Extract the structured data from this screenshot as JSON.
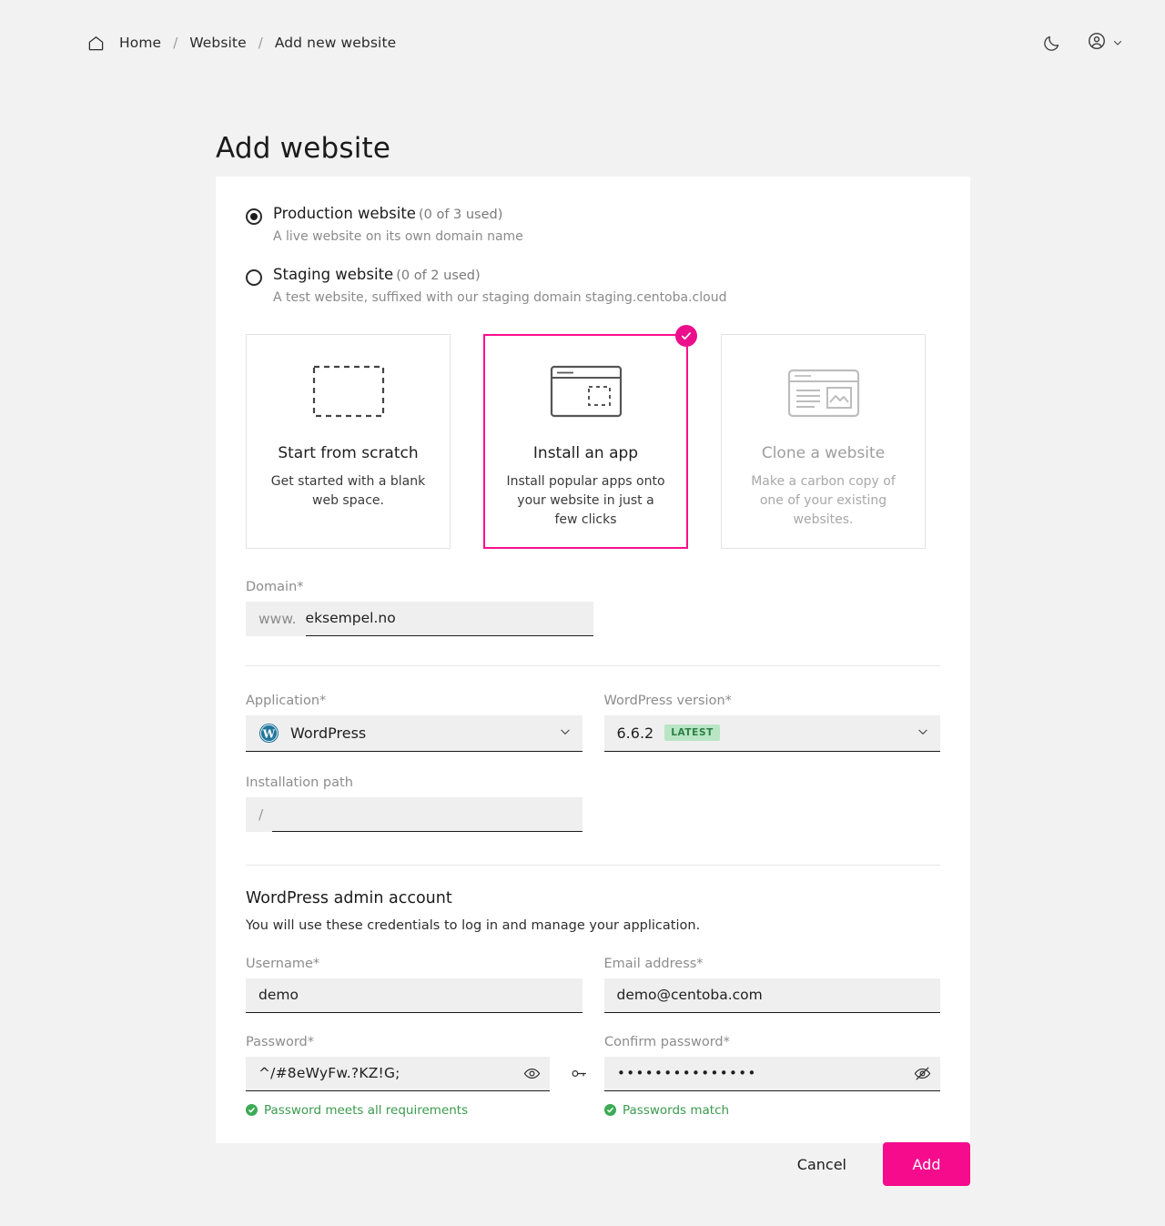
{
  "breadcrumb": {
    "home_icon": "home-icon",
    "items": [
      {
        "label": "Home"
      },
      {
        "label": "Website"
      },
      {
        "label": "Add new website"
      }
    ],
    "separator": "/"
  },
  "topbar": {
    "theme_icon": "moon-icon",
    "account_icon": "user-circle-icon",
    "account_chevron": "chevron-down-icon"
  },
  "page": {
    "title": "Add website"
  },
  "website_type": {
    "options": [
      {
        "title": "Production website",
        "count": "(0 of 3 used)",
        "description": "A live website on its own domain name",
        "selected": true
      },
      {
        "title": "Staging website",
        "count": "(0 of 2 used)",
        "description": "A test website, suffixed with our staging domain staging.centoba.cloud",
        "selected": false
      }
    ]
  },
  "method_cards": [
    {
      "icon": "dashed-rectangle-icon",
      "title": "Start from scratch",
      "description": "Get started with a blank web space.",
      "selected": false,
      "disabled": false
    },
    {
      "icon": "browser-window-dashed-icon",
      "title": "Install an app",
      "description": "Install popular apps onto your website in just a few clicks",
      "selected": true,
      "disabled": false,
      "badge_icon": "check-circle-icon"
    },
    {
      "icon": "browser-window-content-icon",
      "title": "Clone a website",
      "description": "Make a carbon copy of one of your existing websites.",
      "selected": false,
      "disabled": true
    }
  ],
  "domain": {
    "label": "Domain*",
    "prefix": "www.",
    "value": "eksempel.no"
  },
  "application": {
    "label": "Application*",
    "value": "WordPress",
    "icon": "wordpress-logo-icon",
    "chevron": "chevron-down-icon"
  },
  "version": {
    "label": "WordPress version*",
    "value": "6.6.2",
    "badge": "LATEST",
    "chevron": "chevron-down-icon"
  },
  "installation_path": {
    "label": "Installation path",
    "prefix": "/",
    "value": ""
  },
  "admin_account": {
    "title": "WordPress admin account",
    "subtitle": "You will use these credentials to log in and manage your application.",
    "username": {
      "label": "Username*",
      "value": "demo"
    },
    "email": {
      "label": "Email address*",
      "value": "demo@centoba.com"
    },
    "password": {
      "label": "Password*",
      "value": "^/#8eWyFw.?KZ!G;",
      "toggle_icon": "eye-icon",
      "generate_icon": "key-icon",
      "hint": "Password meets all requirements"
    },
    "confirm_password": {
      "label": "Confirm password*",
      "value": "•••••••••••••••",
      "toggle_icon": "eye-off-icon",
      "hint": "Passwords match"
    }
  },
  "footer": {
    "cancel_label": "Cancel",
    "add_label": "Add"
  },
  "colors": {
    "accent": "#f50b8c",
    "selected_border": "#ff0f8b",
    "badge_green_bg": "#b8e6c4",
    "badge_green_text": "#2f7f46",
    "success": "#3cab55",
    "page_bg": "#f2f2f2",
    "card_bg": "#ffffff",
    "input_bg": "#efefef"
  }
}
